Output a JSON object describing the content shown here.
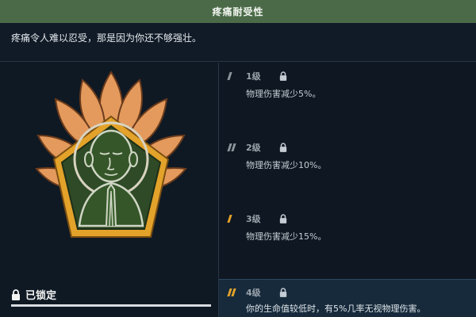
{
  "window": {
    "title": "疼痛耐受性"
  },
  "description": "疼痛令人难以忍受，那是因为你还不够强壮。",
  "status": {
    "icon": "lock-icon",
    "label": "已锁定"
  },
  "badge": {
    "icon": "meditating-monk-lotus-icon"
  },
  "tiers": [
    {
      "label": "1级",
      "text": "物理伤害减少5%。",
      "bars": "dim",
      "locked": true
    },
    {
      "label": "2级",
      "text": "物理伤害减少10%。",
      "bars": "dim",
      "locked": true
    },
    {
      "label": "3级",
      "text": "物理伤害减少15%。",
      "bars": "gold",
      "locked": true
    },
    {
      "label": "4级",
      "text": "你的生命值较低时，有5%几率无视物理伤害。",
      "bars": "gold",
      "locked": true
    }
  ],
  "colors": {
    "header_green": "#4b6b48",
    "accent_gold": "#e3a22a",
    "badge_orange": "#e39a5c",
    "badge_green": "#2f4a26"
  }
}
